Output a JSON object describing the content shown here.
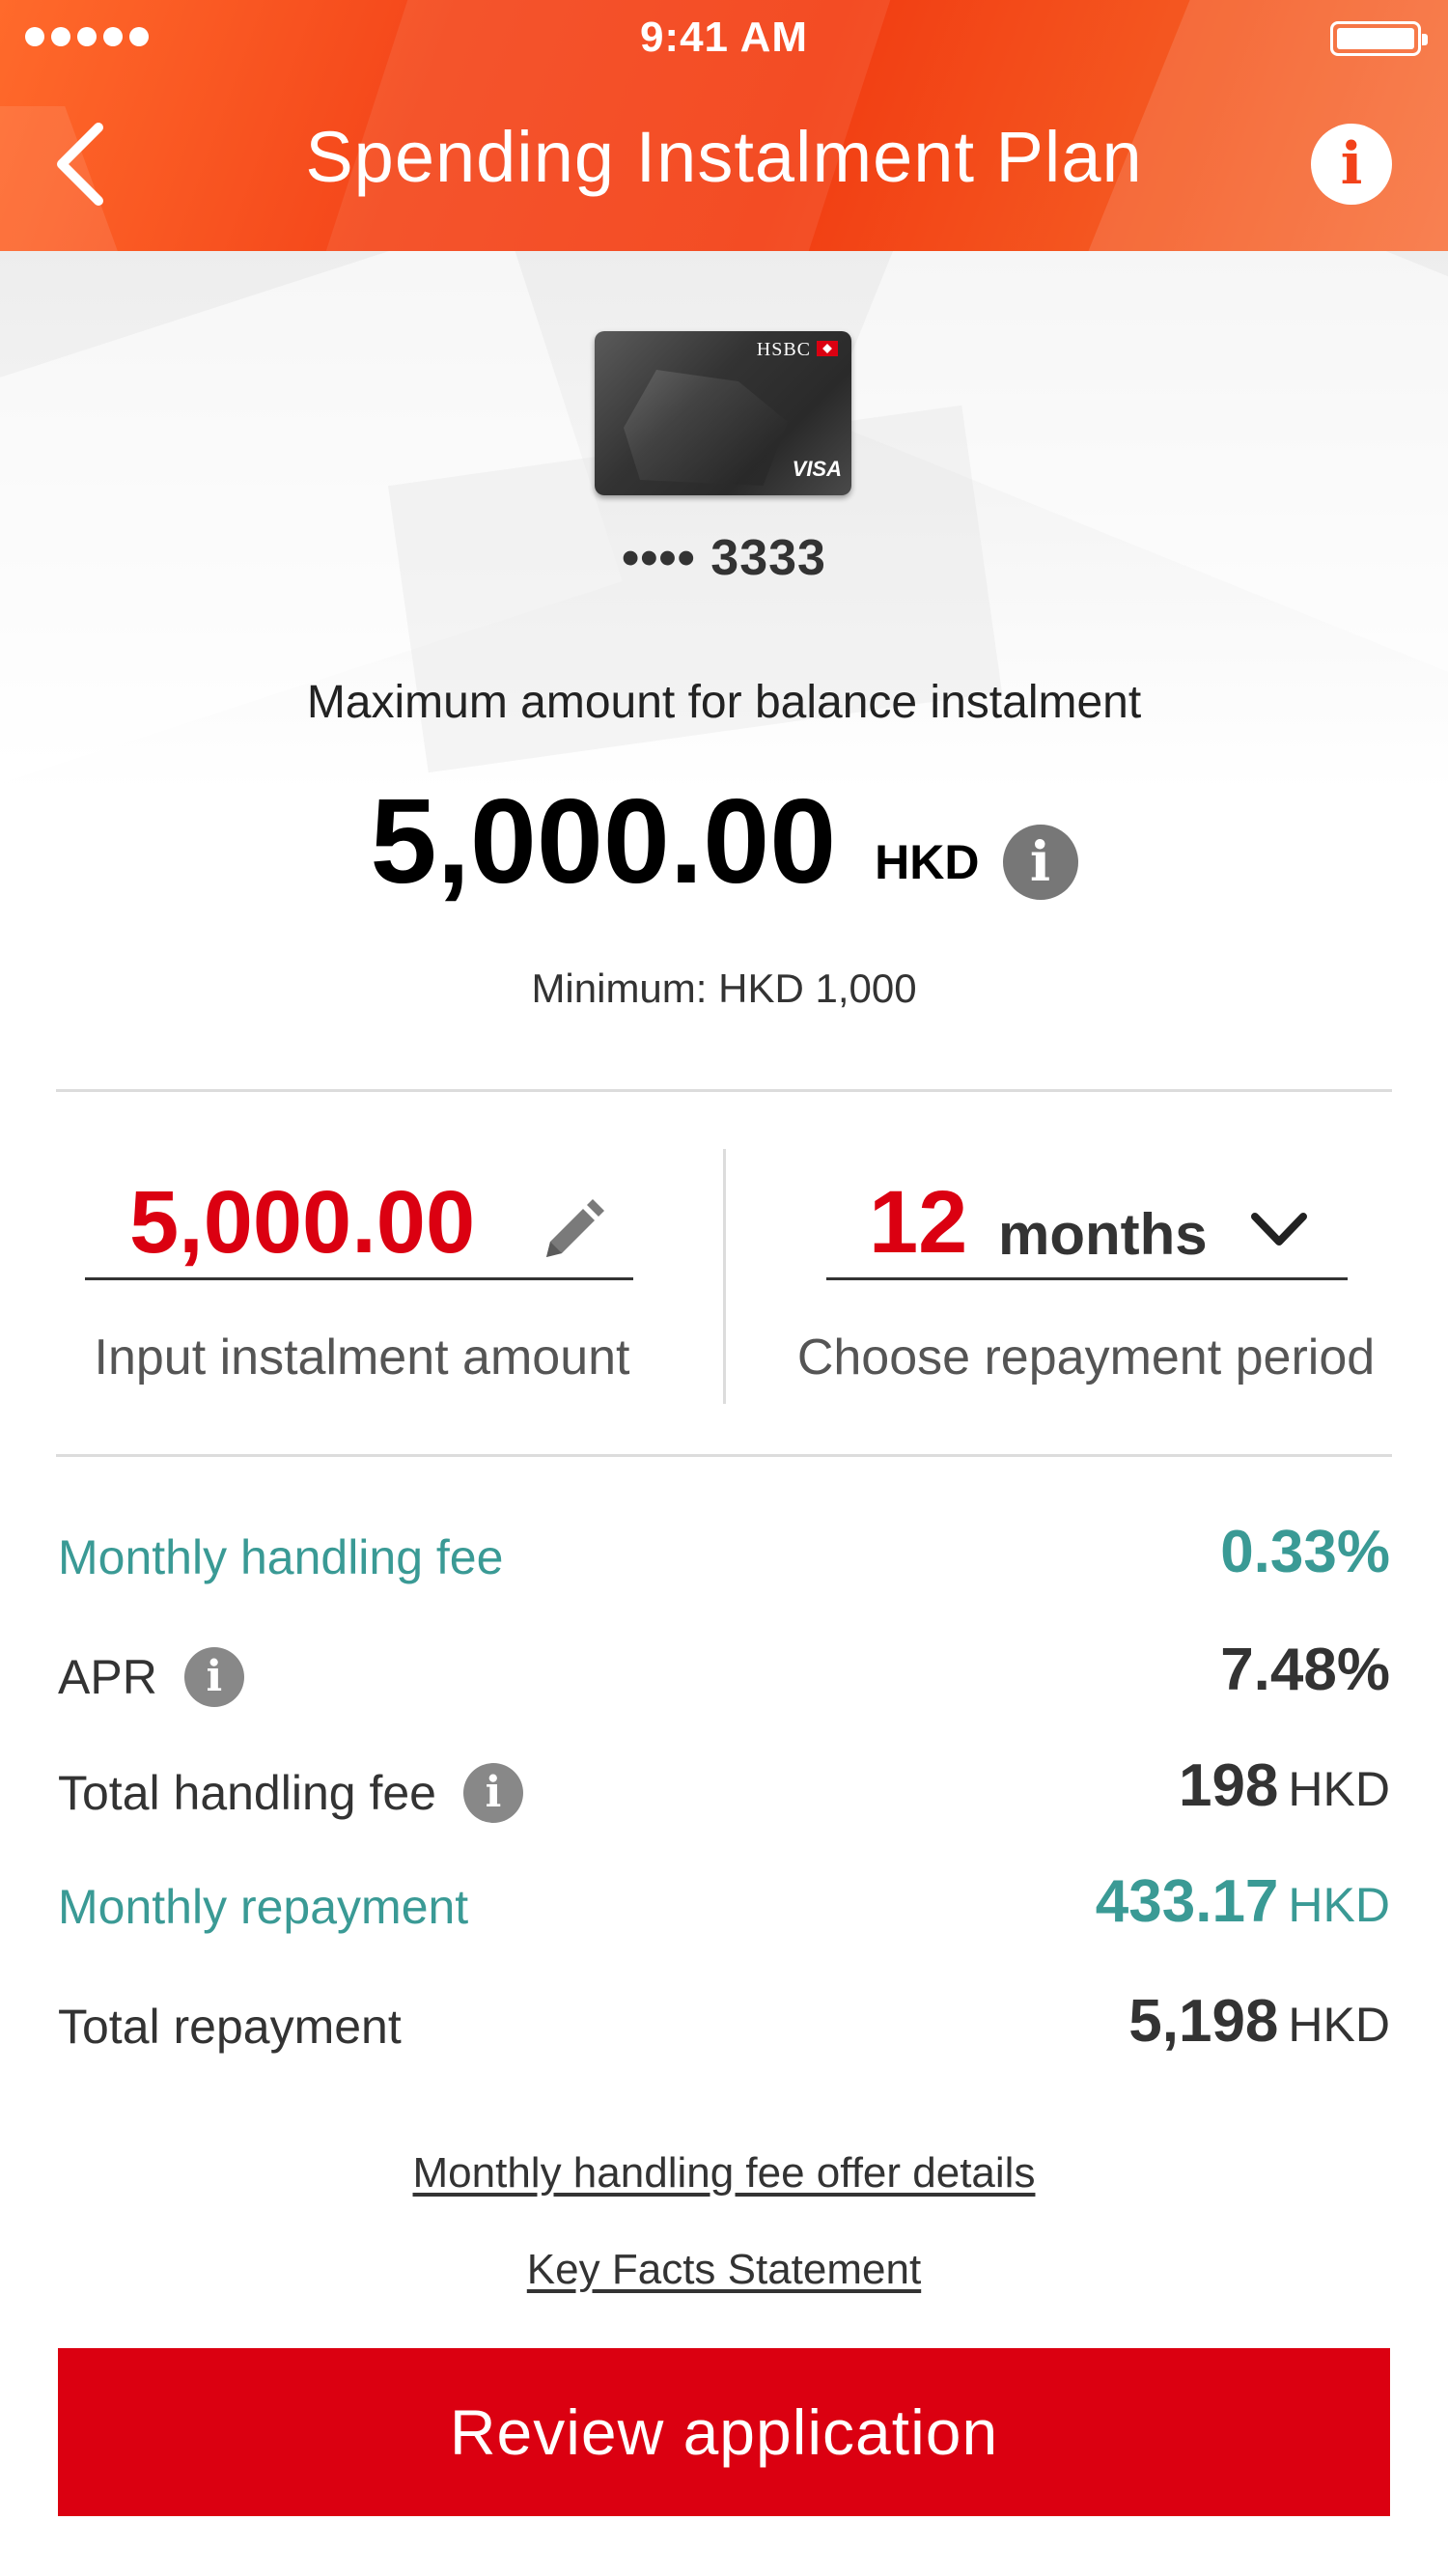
{
  "status_bar": {
    "time": "9:41 AM"
  },
  "header": {
    "title": "Spending Instalment Plan"
  },
  "card": {
    "brand": "HSBC",
    "network": "VISA",
    "number": "•••• 3333"
  },
  "max": {
    "label": "Maximum amount for balance instalment",
    "amount": "5,000.00",
    "currency": "HKD",
    "minimum": "Minimum: HKD 1,000"
  },
  "input": {
    "amount": "5,000.00",
    "amount_caption": "Input instalment amount",
    "period_number": "12",
    "period_unit": "months",
    "period_caption": "Choose repayment period"
  },
  "details": {
    "monthly_fee": {
      "label": "Monthly handling fee",
      "value": "0.33%"
    },
    "apr": {
      "label": "APR",
      "value": "7.48%"
    },
    "total_fee": {
      "label": "Total handling fee",
      "value": "198",
      "currency": "HKD"
    },
    "monthly_repayment": {
      "label": "Monthly repayment",
      "value": "433.17",
      "currency": "HKD"
    },
    "total_repayment": {
      "label": "Total repayment",
      "value": "5,198",
      "currency": "HKD"
    }
  },
  "links": {
    "offer_details": "Monthly handling fee offer details",
    "key_facts": "Key Facts Statement"
  },
  "review_button": "Review application",
  "colors": {
    "accent_red": "#db0011",
    "header_orange": "#f2421a",
    "teal": "#3a9a95"
  }
}
